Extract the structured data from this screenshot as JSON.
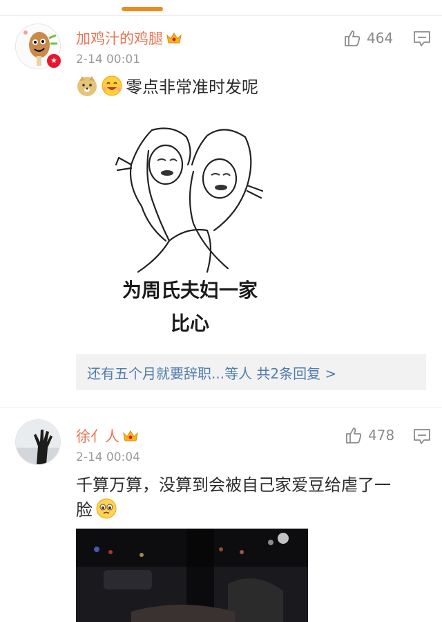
{
  "comments": [
    {
      "username": "加鸡汁的鸡腿",
      "time": "2-14 00:01",
      "likes": "464",
      "text": "零点非常准时发呢",
      "meme_caption_line1": "为周氏夫妇一家",
      "meme_caption_line2": "比心",
      "reply_summary": "还有五个月就要辞职...等人  共2条回复 >"
    },
    {
      "username": "徐亻人",
      "time": "2-14 00:04",
      "likes": "478",
      "text_line1": "千算万算，没算到会被自己家爱豆给虐了一",
      "text_line2": "脸"
    }
  ],
  "icons": {
    "like": "thumbs-up-icon",
    "reply": "comment-icon",
    "crown": "vip-crown-icon",
    "verified": "verified-badge-icon"
  },
  "colors": {
    "username": "#eb7350",
    "link": "#507daf",
    "accent": "#f08a1d",
    "verified": "#e6162d"
  }
}
